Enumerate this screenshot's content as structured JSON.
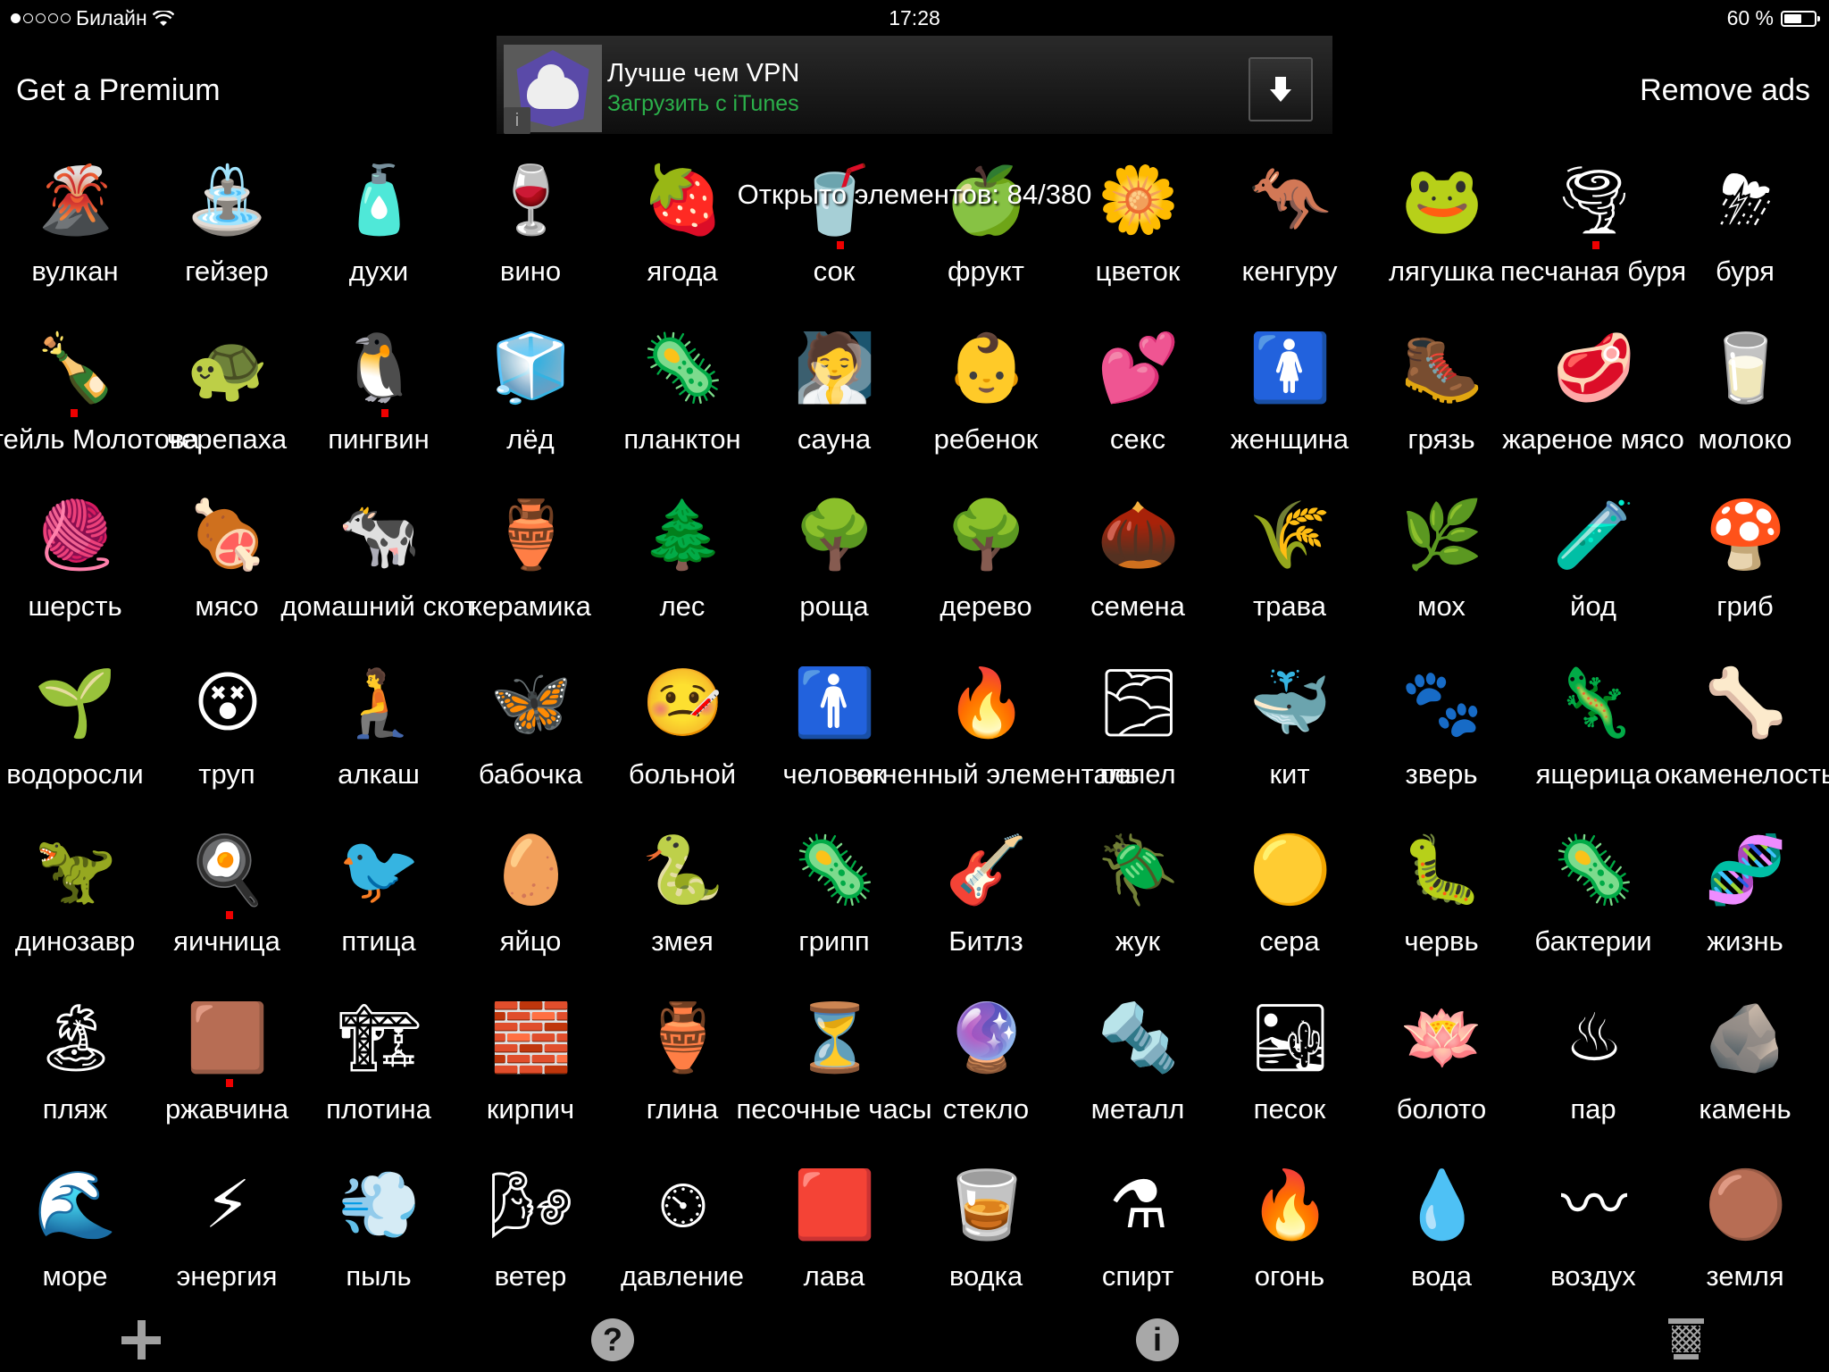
{
  "status_bar": {
    "signal_bars_filled": 1,
    "signal_bars_total": 5,
    "carrier": "Билайн",
    "wifi_icon": "wifi-icon",
    "time": "17:28",
    "battery_text": "60 %",
    "battery_level": 0.6
  },
  "header": {
    "premium_label": "Get a Premium",
    "remove_ads_label": "Remove ads"
  },
  "ad_banner": {
    "title": "Лучше чем VPN",
    "subtitle": "Загрузить с iTunes",
    "info_icon": "info-icon",
    "download_icon": "download-arrow-icon",
    "subtitle_color": "#2bb04a"
  },
  "counter": {
    "text": "Открыто элементов: 84/380",
    "opened": 84,
    "total": 380
  },
  "elements": [
    {
      "label": "вулкан",
      "glyph": "🌋",
      "new": false
    },
    {
      "label": "гейзер",
      "glyph": "⛲",
      "new": false
    },
    {
      "label": "духи",
      "glyph": "🧴",
      "new": false
    },
    {
      "label": "вино",
      "glyph": "🍷",
      "new": false
    },
    {
      "label": "ягода",
      "glyph": "🍓",
      "new": false
    },
    {
      "label": "сок",
      "glyph": "🥤",
      "new": true
    },
    {
      "label": "фрукт",
      "glyph": "🍏",
      "new": false
    },
    {
      "label": "цветок",
      "glyph": "🌼",
      "new": false
    },
    {
      "label": "кенгуру",
      "glyph": "🦘",
      "new": false
    },
    {
      "label": "лягушка",
      "glyph": "🐸",
      "new": false
    },
    {
      "label": "песчаная буря",
      "glyph": "🌪",
      "new": true
    },
    {
      "label": "буря",
      "glyph": "⛈",
      "new": false
    },
    {
      "label": "коктейль Молотова",
      "glyph": "🍾",
      "new": true
    },
    {
      "label": "черепаха",
      "glyph": "🐢",
      "new": false
    },
    {
      "label": "пингвин",
      "glyph": "🐧",
      "new": true
    },
    {
      "label": "лёд",
      "glyph": "🧊",
      "new": false
    },
    {
      "label": "планктон",
      "glyph": "🦠",
      "new": false
    },
    {
      "label": "сауна",
      "glyph": "🧖",
      "new": false
    },
    {
      "label": "ребенок",
      "glyph": "👶",
      "new": false
    },
    {
      "label": "секс",
      "glyph": "💕",
      "new": false
    },
    {
      "label": "женщина",
      "glyph": "🚺",
      "new": false
    },
    {
      "label": "грязь",
      "glyph": "🥾",
      "new": false
    },
    {
      "label": "жареное мясо",
      "glyph": "🥩",
      "new": false
    },
    {
      "label": "молоко",
      "glyph": "🥛",
      "new": false
    },
    {
      "label": "шерсть",
      "glyph": "🧶",
      "new": false
    },
    {
      "label": "мясо",
      "glyph": "🍖",
      "new": false
    },
    {
      "label": "домашний скот",
      "glyph": "🐄",
      "new": false
    },
    {
      "label": "керамика",
      "glyph": "🏺",
      "new": false
    },
    {
      "label": "лес",
      "glyph": "🌲",
      "new": false
    },
    {
      "label": "роща",
      "glyph": "🌳",
      "new": false
    },
    {
      "label": "дерево",
      "glyph": "🌳",
      "new": false
    },
    {
      "label": "семена",
      "glyph": "🌰",
      "new": false
    },
    {
      "label": "трава",
      "glyph": "🌾",
      "new": false
    },
    {
      "label": "мох",
      "glyph": "🌿",
      "new": false
    },
    {
      "label": "йод",
      "glyph": "🧪",
      "new": false
    },
    {
      "label": "гриб",
      "glyph": "🍄",
      "new": false
    },
    {
      "label": "водоросли",
      "glyph": "🌱",
      "new": false
    },
    {
      "label": "труп",
      "glyph": "😵",
      "new": false
    },
    {
      "label": "алкаш",
      "glyph": "🧎",
      "new": false
    },
    {
      "label": "бабочка",
      "glyph": "🦋",
      "new": false
    },
    {
      "label": "больной",
      "glyph": "🤒",
      "new": false
    },
    {
      "label": "человек",
      "glyph": "🚹",
      "new": false
    },
    {
      "label": "огненный элементаль",
      "glyph": "🔥",
      "new": false
    },
    {
      "label": "пепел",
      "glyph": "🌫",
      "new": false
    },
    {
      "label": "кит",
      "glyph": "🐳",
      "new": false
    },
    {
      "label": "зверь",
      "glyph": "🐾",
      "new": false
    },
    {
      "label": "ящерица",
      "glyph": "🦎",
      "new": false
    },
    {
      "label": "окаменелость",
      "glyph": "🦴",
      "new": false
    },
    {
      "label": "динозавр",
      "glyph": "🦖",
      "new": false
    },
    {
      "label": "яичница",
      "glyph": "🍳",
      "new": true
    },
    {
      "label": "птица",
      "glyph": "🐦",
      "new": false
    },
    {
      "label": "яйцо",
      "glyph": "🥚",
      "new": false
    },
    {
      "label": "змея",
      "glyph": "🐍",
      "new": false
    },
    {
      "label": "грипп",
      "glyph": "🦠",
      "new": false
    },
    {
      "label": "Битлз",
      "glyph": "🎸",
      "new": false
    },
    {
      "label": "жук",
      "glyph": "🪲",
      "new": false
    },
    {
      "label": "сера",
      "glyph": "🟡",
      "new": false
    },
    {
      "label": "червь",
      "glyph": "🐛",
      "new": false
    },
    {
      "label": "бактерии",
      "glyph": "🦠",
      "new": false
    },
    {
      "label": "жизнь",
      "glyph": "🧬",
      "new": false
    },
    {
      "label": "пляж",
      "glyph": "🏝",
      "new": false
    },
    {
      "label": "ржавчина",
      "glyph": "🟫",
      "new": true
    },
    {
      "label": "плотина",
      "glyph": "🏗",
      "new": false
    },
    {
      "label": "кирпич",
      "glyph": "🧱",
      "new": false
    },
    {
      "label": "глина",
      "glyph": "🏺",
      "new": false
    },
    {
      "label": "песочные часы",
      "glyph": "⏳",
      "new": false
    },
    {
      "label": "стекло",
      "glyph": "🔮",
      "new": false
    },
    {
      "label": "металл",
      "glyph": "🔩",
      "new": false
    },
    {
      "label": "песок",
      "glyph": "🏜",
      "new": false
    },
    {
      "label": "болото",
      "glyph": "🪷",
      "new": false
    },
    {
      "label": "пар",
      "glyph": "♨",
      "new": false
    },
    {
      "label": "камень",
      "glyph": "🪨",
      "new": false
    },
    {
      "label": "море",
      "glyph": "🌊",
      "new": false
    },
    {
      "label": "энергия",
      "glyph": "⚡",
      "new": false
    },
    {
      "label": "пыль",
      "glyph": "💨",
      "new": false
    },
    {
      "label": "ветер",
      "glyph": "🌬",
      "new": false
    },
    {
      "label": "давление",
      "glyph": "⏲",
      "new": false
    },
    {
      "label": "лава",
      "glyph": "🟥",
      "new": false
    },
    {
      "label": "водка",
      "glyph": "🥃",
      "new": false
    },
    {
      "label": "спирт",
      "glyph": "⚗",
      "new": false
    },
    {
      "label": "огонь",
      "glyph": "🔥",
      "new": false
    },
    {
      "label": "вода",
      "glyph": "💧",
      "new": false
    },
    {
      "label": "воздух",
      "glyph": "〰",
      "new": false
    },
    {
      "label": "земля",
      "glyph": "🟤",
      "new": false
    }
  ],
  "toolbar": {
    "add_icon": "plus-icon",
    "help_glyph": "?",
    "info_glyph": "i",
    "trash_icon": "trash-icon"
  }
}
